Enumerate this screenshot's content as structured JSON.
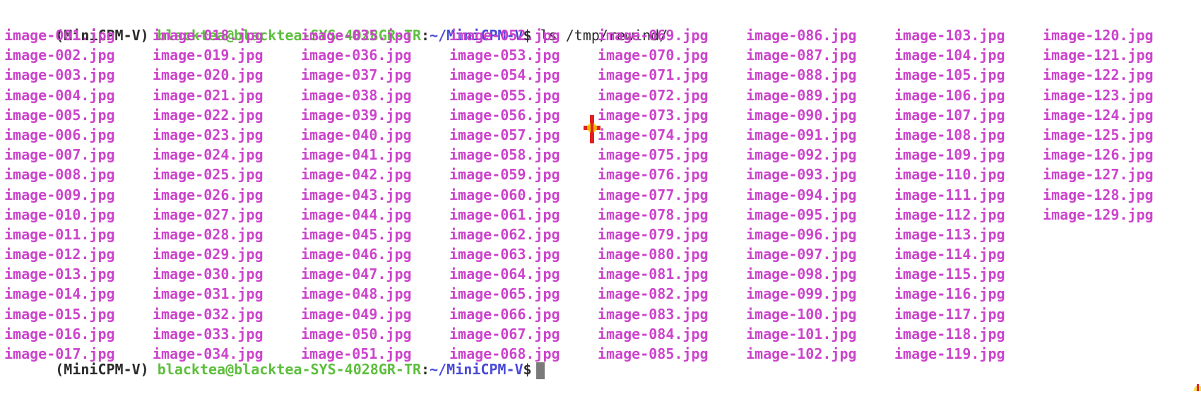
{
  "terminal": {
    "prompt": {
      "env": "(MiniCPM-V)",
      "user_host": "blacktea@blacktea-SYS-4028GR-TR",
      "colon": ":",
      "path": "~/MiniCPM-V",
      "symbol": "$"
    },
    "command": "ls /tmp/rewind/",
    "files": [
      "image-001.jpg",
      "image-002.jpg",
      "image-003.jpg",
      "image-004.jpg",
      "image-005.jpg",
      "image-006.jpg",
      "image-007.jpg",
      "image-008.jpg",
      "image-009.jpg",
      "image-010.jpg",
      "image-011.jpg",
      "image-012.jpg",
      "image-013.jpg",
      "image-014.jpg",
      "image-015.jpg",
      "image-016.jpg",
      "image-017.jpg",
      "image-018.jpg",
      "image-019.jpg",
      "image-020.jpg",
      "image-021.jpg",
      "image-022.jpg",
      "image-023.jpg",
      "image-024.jpg",
      "image-025.jpg",
      "image-026.jpg",
      "image-027.jpg",
      "image-028.jpg",
      "image-029.jpg",
      "image-030.jpg",
      "image-031.jpg",
      "image-032.jpg",
      "image-033.jpg",
      "image-034.jpg",
      "image-035.jpg",
      "image-036.jpg",
      "image-037.jpg",
      "image-038.jpg",
      "image-039.jpg",
      "image-040.jpg",
      "image-041.jpg",
      "image-042.jpg",
      "image-043.jpg",
      "image-044.jpg",
      "image-045.jpg",
      "image-046.jpg",
      "image-047.jpg",
      "image-048.jpg",
      "image-049.jpg",
      "image-050.jpg",
      "image-051.jpg",
      "image-052.jpg",
      "image-053.jpg",
      "image-054.jpg",
      "image-055.jpg",
      "image-056.jpg",
      "image-057.jpg",
      "image-058.jpg",
      "image-059.jpg",
      "image-060.jpg",
      "image-061.jpg",
      "image-062.jpg",
      "image-063.jpg",
      "image-064.jpg",
      "image-065.jpg",
      "image-066.jpg",
      "image-067.jpg",
      "image-068.jpg",
      "image-069.jpg",
      "image-070.jpg",
      "image-071.jpg",
      "image-072.jpg",
      "image-073.jpg",
      "image-074.jpg",
      "image-075.jpg",
      "image-076.jpg",
      "image-077.jpg",
      "image-078.jpg",
      "image-079.jpg",
      "image-080.jpg",
      "image-081.jpg",
      "image-082.jpg",
      "image-083.jpg",
      "image-084.jpg",
      "image-085.jpg",
      "image-086.jpg",
      "image-087.jpg",
      "image-088.jpg",
      "image-089.jpg",
      "image-090.jpg",
      "image-091.jpg",
      "image-092.jpg",
      "image-093.jpg",
      "image-094.jpg",
      "image-095.jpg",
      "image-096.jpg",
      "image-097.jpg",
      "image-098.jpg",
      "image-099.jpg",
      "image-100.jpg",
      "image-101.jpg",
      "image-102.jpg",
      "image-103.jpg",
      "image-104.jpg",
      "image-105.jpg",
      "image-106.jpg",
      "image-107.jpg",
      "image-108.jpg",
      "image-109.jpg",
      "image-110.jpg",
      "image-111.jpg",
      "image-112.jpg",
      "image-113.jpg",
      "image-114.jpg",
      "image-115.jpg",
      "image-116.jpg",
      "image-117.jpg",
      "image-118.jpg",
      "image-119.jpg",
      "image-120.jpg",
      "image-121.jpg",
      "image-122.jpg",
      "image-123.jpg",
      "image-124.jpg",
      "image-125.jpg",
      "image-126.jpg",
      "image-127.jpg",
      "image-128.jpg",
      "image-129.jpg"
    ]
  },
  "colors": {
    "background": "#ffffff",
    "file_color": "#cc44cc",
    "user_host_color": "#5dbf3d",
    "path_color": "#4a4ad6",
    "text_color": "#2b2b2b",
    "cursor_color": "#7a7a7a"
  },
  "icons": {
    "mouse_cursor": "crosshair-cursor-icon"
  }
}
